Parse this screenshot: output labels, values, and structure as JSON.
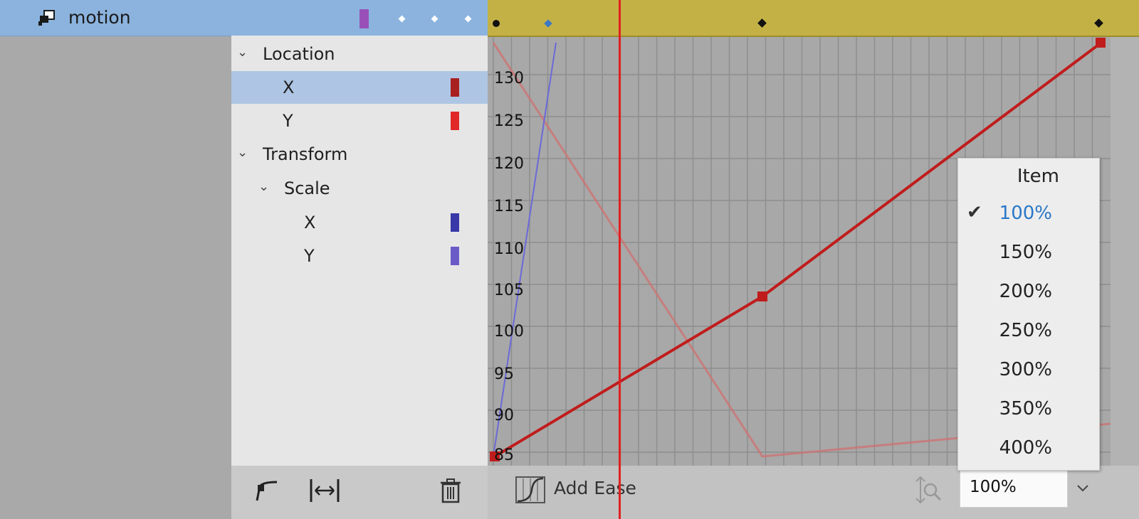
{
  "layer": {
    "name": "motion",
    "swatch_color": "#9850b8"
  },
  "properties": [
    {
      "label": "Location",
      "type": "group",
      "expanded": true
    },
    {
      "label": "X",
      "type": "channel",
      "selected": true,
      "color": "#a82020"
    },
    {
      "label": "Y",
      "type": "channel",
      "selected": false,
      "color": "#e02828"
    },
    {
      "label": "Transform",
      "type": "group",
      "expanded": true
    },
    {
      "label": "Scale",
      "type": "group",
      "expanded": true
    },
    {
      "label": "X",
      "type": "channel",
      "selected": false,
      "color": "#3838a8"
    },
    {
      "label": "Y",
      "type": "channel",
      "selected": false,
      "color": "#6a5ac8"
    }
  ],
  "graph": {
    "y_ticks": [
      "130",
      "125",
      "120",
      "115",
      "110",
      "105",
      "100",
      "95",
      "90",
      "85"
    ],
    "curve_color": "#c01c1c",
    "playhead_color": "#e02020"
  },
  "toolbar": {
    "add_ease_label": "Add Ease",
    "zoom_value": "100%"
  },
  "zoom_menu": {
    "header": "Item",
    "options": [
      "100%",
      "150%",
      "200%",
      "250%",
      "300%",
      "350%",
      "400%"
    ],
    "selected": "100%"
  },
  "icons": [
    "layer-icon",
    "chevron-down-icon",
    "ease-curve-icon",
    "fit-width-icon",
    "trash-icon",
    "add-ease-icon",
    "zoom-fit-icon",
    "checkmark-icon"
  ]
}
